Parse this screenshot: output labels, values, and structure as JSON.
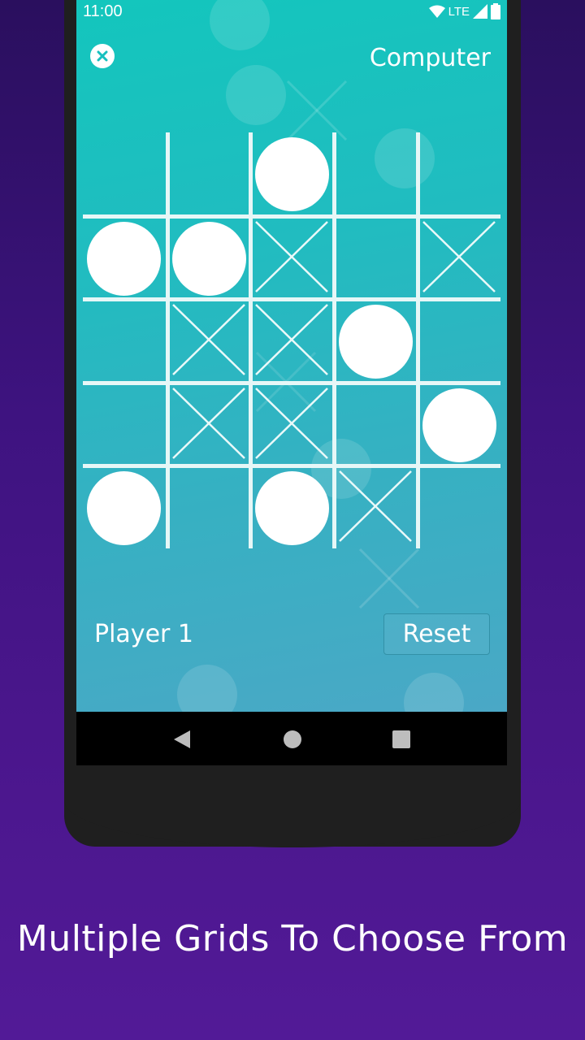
{
  "status_bar": {
    "time": "11:00",
    "network": "LTE"
  },
  "header": {
    "close_icon": "close-icon",
    "opponent": "Computer"
  },
  "board": {
    "size": 5,
    "cells": [
      [
        "",
        "",
        "O",
        "",
        ""
      ],
      [
        "O",
        "O",
        "X",
        "",
        "X"
      ],
      [
        "",
        "X",
        "X",
        "O",
        ""
      ],
      [
        "",
        "X",
        "X",
        "",
        "O"
      ],
      [
        "O",
        "",
        "O",
        "X",
        ""
      ]
    ]
  },
  "footer": {
    "current_player": "Player 1",
    "reset_label": "Reset"
  },
  "nav": {
    "back": "back-icon",
    "home": "home-icon",
    "recents": "recents-icon"
  },
  "caption": "Multiple Grids To Choose From"
}
